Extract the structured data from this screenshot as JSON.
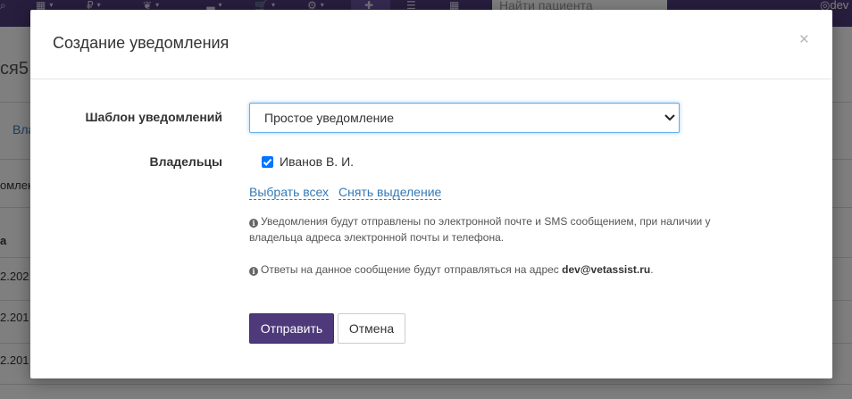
{
  "background": {
    "search_placeholder": "Найти пациента",
    "user": "dev",
    "page_title_fragment": "ся5",
    "link_fragment": "Вла",
    "cell_fragment_1": "омлен",
    "header_fragment": "а",
    "row_dates": [
      "2.202",
      "2.201",
      "2.201"
    ]
  },
  "modal": {
    "title": "Создание уведомления",
    "close": "×",
    "template_label": "Шаблон уведомлений",
    "template_value": "Простое уведомление",
    "owners_label": "Владельцы",
    "owner_name": "Иванов В. И.",
    "owner_checked": true,
    "select_all": "Выбрать всех",
    "deselect": "Снять выделение",
    "info_1": "Уведомления будут отправлены по электронной почте и SMS сообщением, при наличии у владельца адреса электронной почты и телефона.",
    "info_2_prefix": "Ответы на данное сообщение будут отправляться на адрес",
    "info_2_email": "dev@vetassist.ru",
    "info_2_suffix": ".",
    "send_button": "Отправить",
    "cancel_button": "Отмена"
  },
  "colors": {
    "brand": "#4e3a7b",
    "link": "#337ab7",
    "checkbox": "#0075ff"
  }
}
